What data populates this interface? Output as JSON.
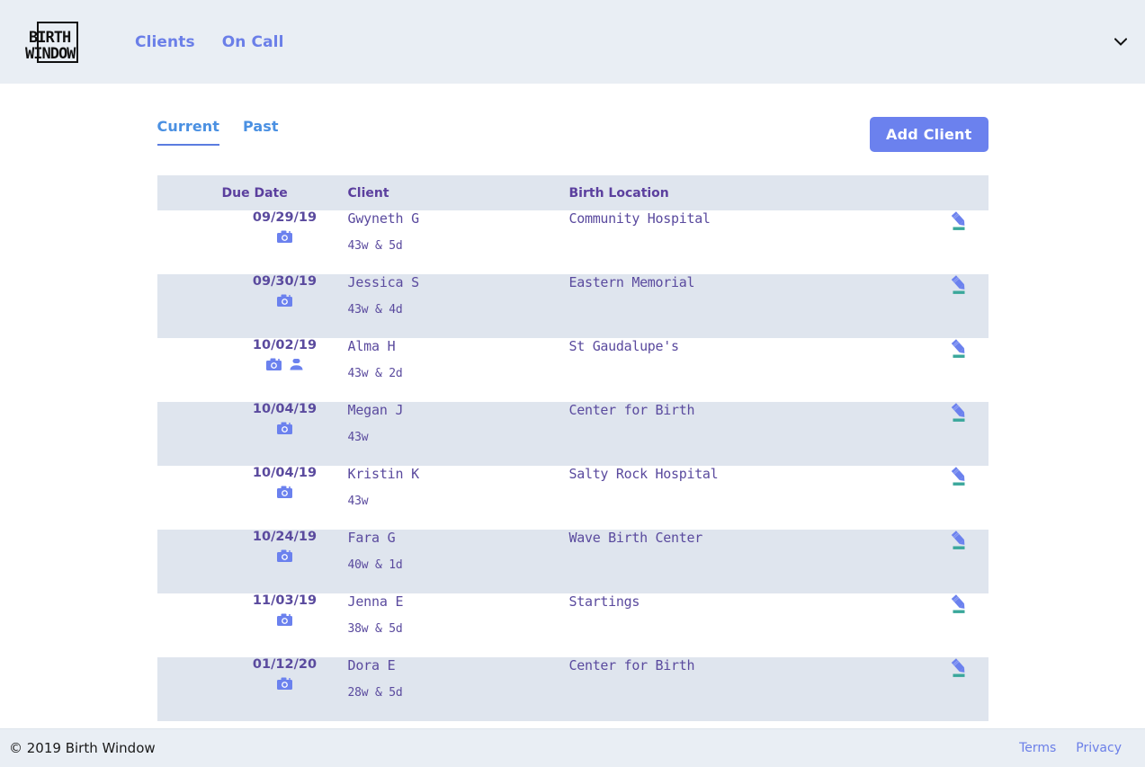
{
  "nav": {
    "logo": {
      "name": "birth-window-logo",
      "line1": "BIRTH",
      "line2": "WINDOW"
    },
    "links": [
      {
        "label": "Clients"
      },
      {
        "label": "On Call"
      }
    ],
    "caret_icon": "chevron-down-icon"
  },
  "toolbar": {
    "tabs": [
      {
        "label": "Current",
        "active": true
      },
      {
        "label": "Past",
        "active": false
      }
    ],
    "add_client_label": "Add Client"
  },
  "table": {
    "headers": [
      "",
      "Due Date",
      "Client",
      "Birth Location",
      ""
    ],
    "rows": [
      {
        "date": "09/29/19",
        "client": "Gwyneth G",
        "gestation": "43w & 5d",
        "location": "Community Hospital",
        "icons": [
          "camera-icon"
        ]
      },
      {
        "date": "09/30/19",
        "client": "Jessica S",
        "gestation": "43w & 4d",
        "location": "Eastern Memorial",
        "icons": [
          "camera-icon"
        ]
      },
      {
        "date": "10/02/19",
        "client": "Alma H",
        "gestation": "43w & 2d",
        "location": "St Gaudalupe's",
        "icons": [
          "camera-icon",
          "person-icon"
        ]
      },
      {
        "date": "10/04/19",
        "client": "Megan J",
        "gestation": "43w",
        "location": "Center for Birth",
        "icons": [
          "camera-icon"
        ]
      },
      {
        "date": "10/04/19",
        "client": "Kristin K",
        "gestation": "43w",
        "location": "Salty Rock Hospital",
        "icons": [
          "camera-icon"
        ]
      },
      {
        "date": "10/24/19",
        "client": "Fara G",
        "gestation": "40w & 1d",
        "location": "Wave Birth Center",
        "icons": [
          "camera-icon"
        ]
      },
      {
        "date": "11/03/19",
        "client": "Jenna E",
        "gestation": "38w & 5d",
        "location": "Startings",
        "icons": [
          "camera-icon"
        ]
      },
      {
        "date": "01/12/20",
        "client": "Dora E",
        "gestation": "28w & 5d",
        "location": "Center for Birth",
        "icons": [
          "camera-icon"
        ]
      }
    ],
    "edit_icon": "pencil-edit-icon"
  },
  "footer": {
    "copyright": "© 2019 Birth Window",
    "links": [
      {
        "label": "Terms"
      },
      {
        "label": "Privacy"
      }
    ]
  },
  "colors": {
    "accent_blue": "#6b81ee",
    "nav_bg": "#e9eef4",
    "row_alt_bg": "#dfe5ee",
    "text_purple": "#5a4a9e",
    "header_purple": "#5b3f9e",
    "tab_active": "#4a90e2",
    "pencil_blue": "#6b81ee",
    "pencil_teal": "#3aa79b"
  }
}
